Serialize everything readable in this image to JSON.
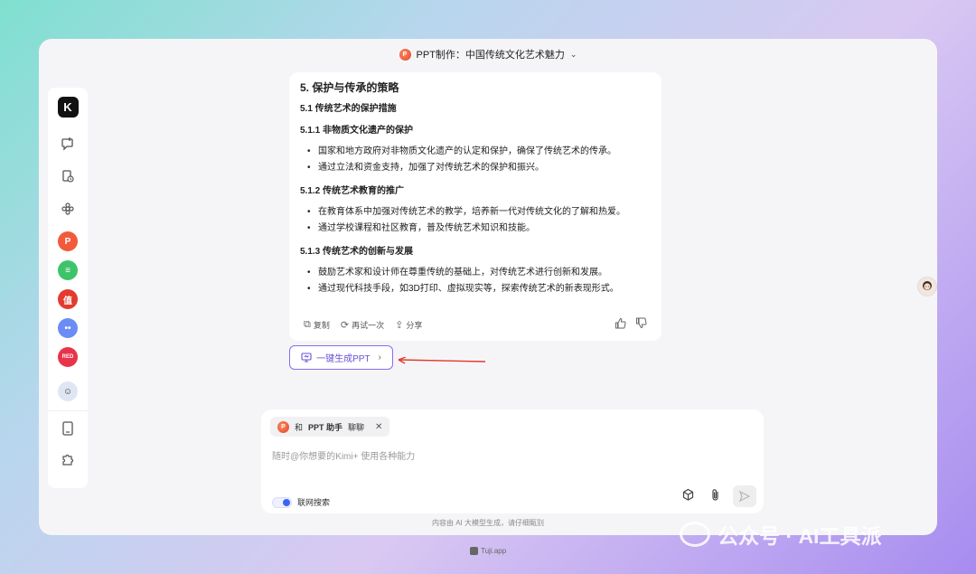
{
  "window": {
    "title": "PPT制作：中国传统文化艺术魅力",
    "title_icon": "ppt-app-icon",
    "dropdown_icon": "chevron-down-icon"
  },
  "sidebar": {
    "logo": "K",
    "items": [
      {
        "name": "new-chat",
        "icon": "chat-plus-icon"
      },
      {
        "name": "history",
        "icon": "history-icon"
      },
      {
        "name": "explore",
        "icon": "flower-icon"
      },
      {
        "name": "ppt-assistant",
        "icon": "ppt-icon",
        "label": "P",
        "color": "#f15a3a"
      },
      {
        "name": "doc-app",
        "icon": "doc-icon",
        "label": "≡",
        "color": "#3fc36a"
      },
      {
        "name": "zhi-app",
        "icon": "zhi-icon",
        "label": "值",
        "color": "#e33b2f"
      },
      {
        "name": "bot-app",
        "icon": "bot-icon",
        "label": "••",
        "color": "#6c8cf5"
      },
      {
        "name": "red-app",
        "icon": "red-icon",
        "label": "RED",
        "color": "#e8334a"
      },
      {
        "name": "user-avatar",
        "icon": "avatar-icon"
      },
      {
        "name": "tablet",
        "icon": "tablet-icon"
      },
      {
        "name": "plugin",
        "icon": "puzzle-icon"
      }
    ]
  },
  "content": {
    "h1": "5. 保护与传承的策略",
    "h2": "5.1 传统艺术的保护措施",
    "sections": [
      {
        "title": "5.1.1 非物质文化遗产的保护",
        "bullets": [
          "国家和地方政府对非物质文化遗产的认定和保护，确保了传统艺术的传承。",
          "通过立法和资金支持，加强了对传统艺术的保护和振兴。"
        ]
      },
      {
        "title": "5.1.2 传统艺术教育的推广",
        "bullets": [
          "在教育体系中加强对传统艺术的教学，培养新一代对传统文化的了解和热爱。",
          "通过学校课程和社区教育，普及传统艺术知识和技能。"
        ]
      },
      {
        "title": "5.1.3 传统艺术的创新与发展",
        "bullets": [
          "鼓励艺术家和设计师在尊重传统的基础上，对传统艺术进行创新和发展。",
          "通过现代科技手段，如3D打印、虚拟现实等，探索传统艺术的新表现形式。"
        ]
      }
    ],
    "actions": {
      "copy": "复制",
      "retry": "再试一次",
      "share": "分享"
    }
  },
  "generate_ppt": {
    "label": "一键生成PPT",
    "chevron": "›"
  },
  "composer": {
    "chip_prefix": "和",
    "chip_name": "PPT 助手",
    "chip_suffix": "聊聊",
    "chip_close": "✕",
    "placeholder": "随时@你想要的Kimi+ 使用各种能力",
    "web_search_label": "联网搜索",
    "web_search_on": true
  },
  "disclaimer": "内容由 AI 大模型生成，请仔细甄别",
  "footer": {
    "brand": "Tuji.app"
  },
  "watermark": {
    "text": "公众号 · AI工具派"
  },
  "colors": {
    "accent": "#7b5cf0",
    "arrow": "#e0392b",
    "ppt_brand": "#e1442c"
  }
}
